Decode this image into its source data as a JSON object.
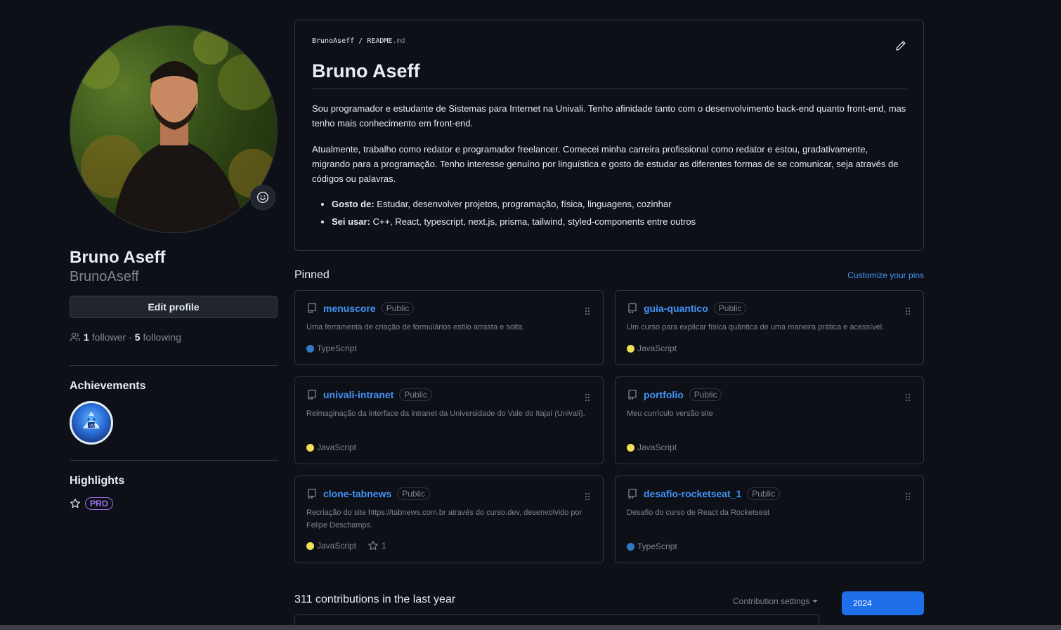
{
  "profile": {
    "fullname": "Bruno Aseff",
    "username": "BrunoAseff",
    "edit_label": "Edit profile",
    "followers_count": "1",
    "followers_label": "follower",
    "separator": "·",
    "following_count": "5",
    "following_label": "following"
  },
  "achievements": {
    "title": "Achievements"
  },
  "highlights": {
    "title": "Highlights",
    "pro_label": "PRO"
  },
  "readme": {
    "path_user": "BrunoAseff",
    "path_sep": "/",
    "path_file": "README",
    "path_ext": ".md",
    "heading": "Bruno Aseff",
    "para1": "Sou programador e estudante de Sistemas para Internet na Univali. Tenho afinidade tanto com o desenvolvimento back-end quanto front-end, mas tenho mais conhecimento em front-end.",
    "para2": "Atualmente, trabalho como redator e programador freelancer. Comecei minha carreira profissional como redator e estou, gradativamente, migrando para a programação. Tenho interesse genuíno por linguística e gosto de estudar as diferentes formas de se comunicar, seja através de códigos ou palavras.",
    "list": [
      {
        "label": "Gosto de:",
        "text": " Estudar, desenvolver projetos, programação, física, linguagens, cozinhar"
      },
      {
        "label": "Sei usar:",
        "text": " C++, React, typescript, next.js, prisma, tailwind, styled-components entre outros"
      }
    ]
  },
  "pinned": {
    "title": "Pinned",
    "customize_label": "Customize your pins",
    "repos": [
      {
        "name": "menuscore",
        "visibility": "Public",
        "description": "Uma ferramenta de criação de formulários estilo arrasta e solta.",
        "language": "TypeScript",
        "lang_color": "#3178c6",
        "stars": ""
      },
      {
        "name": "guia-quantico",
        "visibility": "Public",
        "description": "Um curso para explicar física quântica de uma maneira prática e acessível.",
        "language": "JavaScript",
        "lang_color": "#f1e05a",
        "stars": ""
      },
      {
        "name": "univali-intranet",
        "visibility": "Public",
        "description": "Reimaginação da interface da intranet da Universidade do Vale do Itajaí (Univali).",
        "language": "JavaScript",
        "lang_color": "#f1e05a",
        "stars": ""
      },
      {
        "name": "portfolio",
        "visibility": "Public",
        "description": "Meu currículo versão site",
        "language": "JavaScript",
        "lang_color": "#f1e05a",
        "stars": ""
      },
      {
        "name": "clone-tabnews",
        "visibility": "Public",
        "description": "Recriação do site https://tabnews.com.br através do curso.dev, desenvolvido por Felipe Deschamps.",
        "language": "JavaScript",
        "lang_color": "#f1e05a",
        "stars": "1"
      },
      {
        "name": "desafio-rocketseat_1",
        "visibility": "Public",
        "description": "Desafio do curso de React da Rocketseat",
        "language": "TypeScript",
        "lang_color": "#3178c6",
        "stars": ""
      }
    ]
  },
  "contributions": {
    "title": "311 contributions in the last year",
    "settings_label": "Contribution settings",
    "year": "2024"
  }
}
